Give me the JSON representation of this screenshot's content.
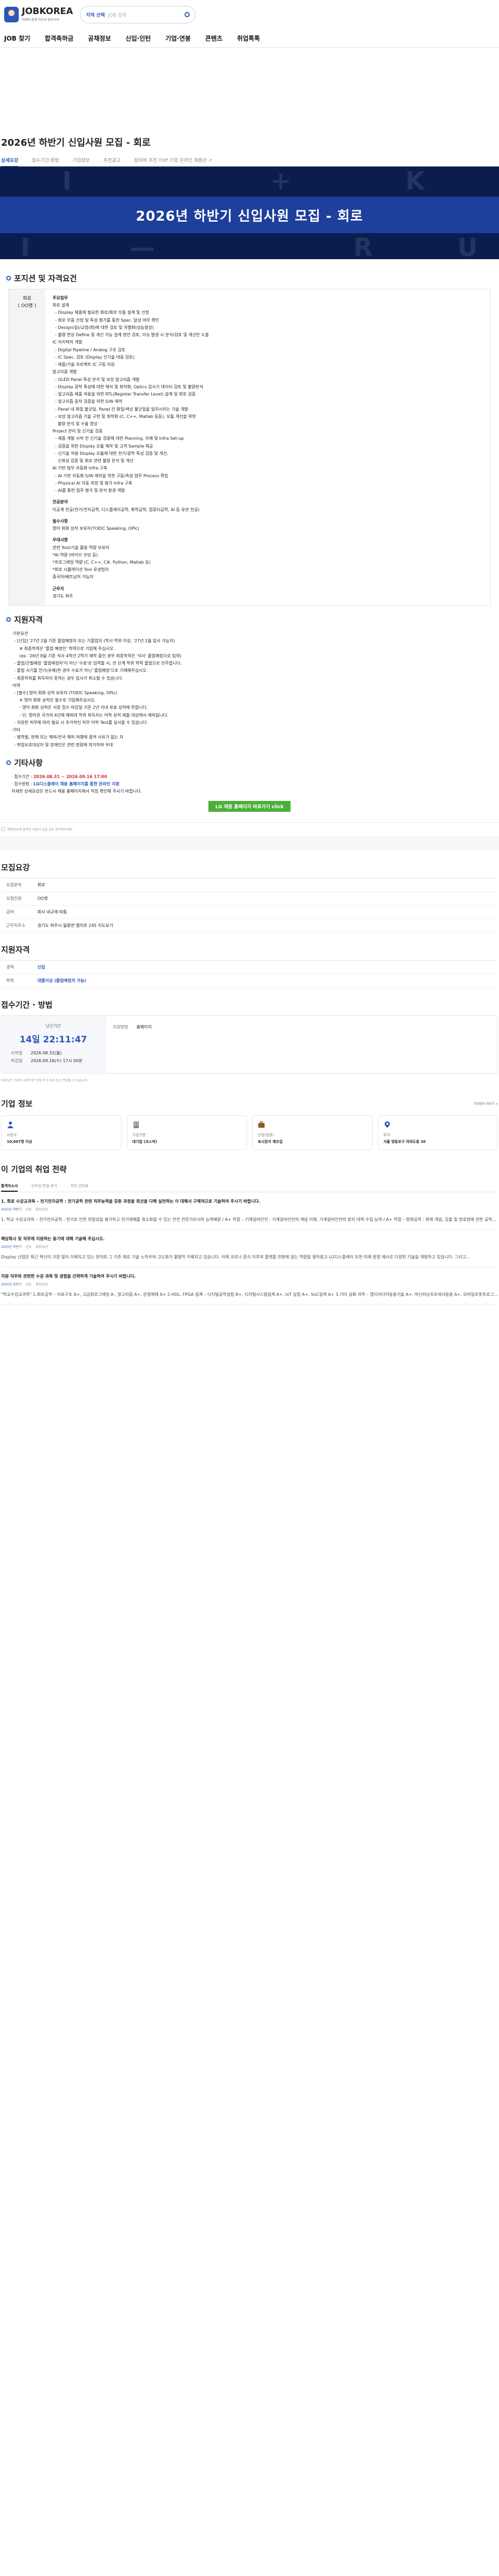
{
  "header": {
    "brand": "JOBKOREA",
    "tagline": "미래와 함께 하우리 잡코리아",
    "search_loc": "지역 선택",
    "search_placeholder": "JOB 검색"
  },
  "nav": [
    "JOB 찾기",
    "합격축하금",
    "공채정보",
    "신입·인턴",
    "기업·연봉",
    "콘텐츠",
    "취업톡톡"
  ],
  "page_title": "2026년 하반기 신입사원 모집 - 회로",
  "tabs": [
    "상세요강",
    "접수기간·방법",
    "기업정보",
    "추천공고",
    "잡아바 추천 TOP 기업 온라인 채용관 ↗"
  ],
  "banner_title": "2026년 하반기 신입사원 모집 - 회로",
  "sections": {
    "position": "포지션 및 자격요건",
    "qualification": "지원자격",
    "other": "기타사항"
  },
  "position": {
    "label1": "회로",
    "label2": "( OO명 )",
    "main_h": "주요업무",
    "main_lines": [
      "회로 설계",
      "  - Display 제품에 필요한 회로/화로 부품 설계 및 선정",
      "  - 회로 부품 선정 및 특성 평가를 통한 Spec. 달성 여부 확인",
      "  - Design(설)/교정(회)에 대한 검토 및 차별화(성능향상)",
      "  - 불량 현상 Define 및 개선 가능 설계 방안 검토, 이슈 발생 시 분석/검토 및 개선안 도출",
      "IC 아키텍처 개발",
      "  - Digital Pipeline / Analog 구조 검토",
      "  - IC Spec. 검토 (Display 신기술 대응 검토)",
      "  - 제품/기술 프로젝트 IC 구동 지원",
      "알고리즘 개발",
      "  - OLED Panel 특성 분석 및 보상 알고리즘 개발",
      "  - Display 광학 특성에 대한 해석 및 최적화, Optics 검사기 데이터 검토 및 불량분석",
      "  - 알고리즘 제품 적용을 위한 RTL(Register Transfer Level) 설계 및 회로 검증",
      "  - 알고리즘 동작 검증을 위한 S/W 제작",
      "  - Panel 내 화질 불균일, Panel 간 화질/색상 불균일을 일치시키는 기술 개발",
      "  - 보상 알고리즘 기술 구현 및 최적화 (C, C++, Matlab 등등), 모듈 개선을 위한",
      "    불량 분석 및 수율 향상",
      "Project 관리 및 신기술 검증",
      "  - 제품 개발 시작 전 신기술 검증에 대한 Planning, 자재 및 Infra Set-up",
      "  - 검증을 위한 Display 모듈 제작 및 고객 Sample 제공",
      "  - 신기술 적용 Display 모듈에 대한 전기/광학 특성 검증 및 개선,",
      "    신뢰성 검증 및 회로 관련 불량 분석 및 개선",
      "AI 기반 업무 자동화 Infra 구축",
      "  - AI 기반 자동화 S/W 제작을 위한 구동/측정 업무 Process 확립",
      "  - Physical AI 자동 측정 및 평가 Infra 구축",
      "  - AI를 통한 업무 평가 및 분석 환경 개발"
    ],
    "major_h": "전공분야",
    "major": "이공계 전공(전기/전자공학, 디스플레이공학, 화학공학, 컴퓨터공학, AI 등 유관 전공)",
    "req_h": "필수사항",
    "req": "영어 회화 성적 보유자(TOEIC Speaking, OPIc)",
    "pref_h": "우대사항",
    "pref_lines": [
      "관련 Tool/기술 활용 역량 보유자",
      "*AI 역량 (바이브 코딩 등)",
      "*프로그래밍 역량 (C, C++, C#, Python, Matlab 등)",
      "*회로 시뮬레이션 Tool 유경험자",
      "중국어/베트남어 가능자"
    ],
    "loc_h": "근무지",
    "loc": "경기도 파주"
  },
  "qualification_lines": [
    "·기본요건",
    "  - [신입] '27년 2월 기준 졸업예정자 또는 기졸업자 (학사 학위 이상, '27년 1월 입사 가능자)",
    "      ※ 최종학력은 '졸업 예정인' 학력으로 기입해 주십시오.",
    "      (ex. '26년 8월 기준 석사 4학년 2학기 재학 중인 경우 최종학력은 '석사' 졸업예정으로 입력)",
    "  - 졸업/군필예정 '졸업예정자'이 아닌 '수료'로 입력할 시, 전 단계 학위 학력 졸업으로 간주합니다.",
    "  - 졸업 시기를 연기(유예)한 경우 수료가 아닌 '졸업예정'으로 기재해주십시오.",
    "  - 최종학위를 취득하지 못하는 경우 입사가 취소될 수 있습니다.",
    "·어학",
    "  - [필수] 영어 회화 성적 보유자 (TOEIC Speaking, OPIc)",
    "      ※ 영어 회화 성적은 필수로 기입해주십시오.",
    "      - 영어 회화 성적은 서류 접수 마감일 기준 2년 이내 유효 성적에 한합니다.",
    "      - 단, 영어권 국가의 4년제 해외대 학위 취득자는 어학 성적 제출 대상에서 제외됩니다.",
    "  - 지원한 직무에 따라 필요 시 추가적인 직무 어학 Test를 실시할 수 있습니다.",
    "·기타",
    "  - 병역필, 면제 또는 해외/전국 해외 여행에 결격 사유가 없는 자",
    "  - 취업보호대상자 및 장애인은 관련 법령에 의거하여 우대"
  ],
  "other": {
    "period_label": "· 접수기간 : ",
    "period_value": "2026.08.31 ~ 2026.09.16 17:00",
    "method_label": "· 접수방법 : ",
    "method_value": "LG디스플레이 채용 홈페이지를 통한 온라인 지원",
    "note": "자세한 상세요강은 반드시 채용 홈페이지에서 직접 확인해 주시기 바랍니다.",
    "button": "LG 채용 홈페이지 바로가기 click"
  },
  "notice1": "채용정보에 잘못된 내용이 있을 경우 문의해주세요.",
  "summary": {
    "title": "모집요강",
    "rows": [
      {
        "k": "모집분야",
        "v": "회로"
      },
      {
        "k": "모집인원",
        "v": "OO명"
      },
      {
        "k": "급여",
        "v": "회사 내규에 따름"
      },
      {
        "k": "근무지주소",
        "v": "경기도 파주시 월롱면 엘지로 245  지도보기"
      }
    ]
  },
  "apply_req": {
    "title": "지원자격",
    "rows": [
      {
        "k": "경력",
        "v": "신입"
      },
      {
        "k": "학력",
        "v": "대졸이상 (졸업예정자 가능)"
      }
    ]
  },
  "period": {
    "title": "접수기간 · 방법",
    "remain_label": "남은기간",
    "remain": "14일 22:11:47",
    "start_k": "시작일",
    "start_v": "2026.08.31(월)",
    "end_k": "마감일",
    "end_v": "2026.09.16(수) 17시 00분",
    "method_k": "지원방법",
    "method_v": "홈페이지"
  },
  "tip": "마감일은 기업의 사정으로 인해 조기 마감 또는 변경될 수 있습니다.",
  "company": {
    "title": "기업 정보",
    "more": "기업정보 더보기 >",
    "cards": [
      {
        "icon": "people-icon",
        "l": "사원수",
        "v": "10,007명 이상"
      },
      {
        "icon": "building-icon",
        "l": "기업구분",
        "v": "대기업 (코스피)"
      },
      {
        "icon": "briefcase-icon",
        "l": "산업(업종)",
        "v": "표시장치 제조업"
      },
      {
        "icon": "pin-icon",
        "l": "위치",
        "v": "서울 영등포구 여의도동 20"
      }
    ]
  },
  "strategy": {
    "title": "이 기업의 취업 전략",
    "tabs": [
      "합격자소서",
      "인적성·면접 후기",
      "직무 인터뷰"
    ],
    "items": [
      {
        "q": "1. 회로 수강교과목 – 전기전자공학 : 전기공학 관련 직무능력을 갖춘 과정을 최선을 다해 실천하는 이 대해서 구체적으로 기술하여 주시기 바랍니다.",
        "year": "2025년 하반기",
        "lvl": "신입",
        "type": "회로/유관",
        "a": "1. 학교 수강교과목 – 전기전자공학 : 전기로 인한 위험성을 평가하고 전기재해를 최소화할 수 있는 안전 전문가로서의 능력배양 / A+ 학점 – 기계설비안전 : 기계설비안전의 개념 이해, 기계설비안전의 방지 대책 수립 능력 / A+ 학점 – 방화공학 : 화재 개념, 검출 및 방호법에 관한 공학적 이론..."
      },
      {
        "q": "해당회사 및 직무에 지원하는 동기에 대해 기술해 주십시오.",
        "year": "2025년 하반기",
        "lvl": "신입",
        "type": "회로/유관",
        "a": "Display 산업은 최근 혁신이 가장 많이 이뤄지고 있는 분야로 그 기존 제로 기술 노하우와 고도화가 활발히 이뤄지고 있습니다. 이에 코로나 종식 이후의 플랫폼 전환에 맞는 역량을 쌓아왔고 LG디스플레이 또한 미래 방향 제시로 다양한 기술을 개발하고 있습니다. 그리고..."
      },
      {
        "q": "지원 직무와 관련한 수강 과목 및 경험을 간략하게 기술하여 주시기 바랍니다.",
        "year": "2025년 상반기",
        "lvl": "신입",
        "type": "회로/유관",
        "a": "\"학교수강교과목\" 1.회로공학 – 자료구조 A+, 고급회로그래밍 A-, 알고리즘 A+, 운영체제 A+ 2.HDL, FPGA 설계 – 디지털공학실험 B+, 디지털시스템설계 A+, IoT 실험 A+, SoC설계 A+ 3.기타 심화 과목 – 멀티미디어응용기술 A+, 머신러닝프로세서응용 A+, 모바일로봇프로그래밍 A0..."
      }
    ]
  },
  "colors": {
    "accent": "#2c56b9",
    "banner": "#1e3f9c",
    "red": "#d42b2b",
    "green": "#4caf3a"
  }
}
